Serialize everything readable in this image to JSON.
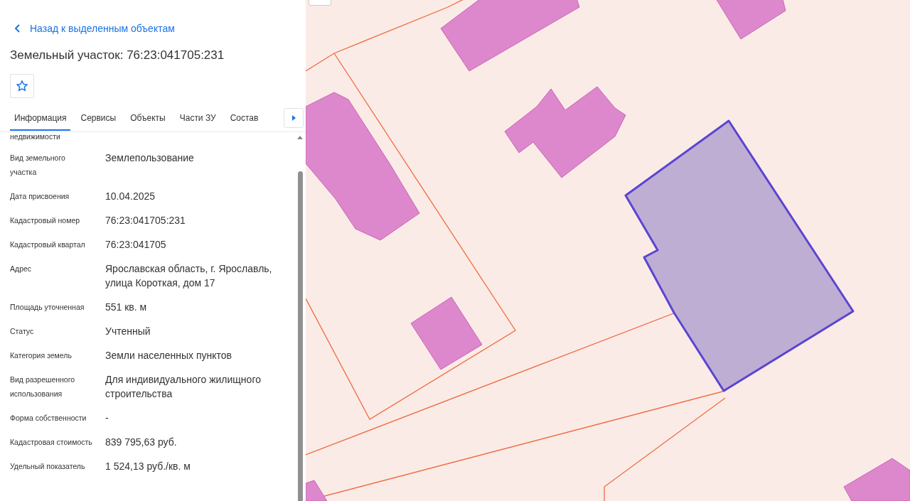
{
  "back_link": {
    "label": "Назад к выделенным объектам"
  },
  "title": "Земельный участок: 76:23:041705:231",
  "tabs": [
    {
      "label": "Информация",
      "selected": true
    },
    {
      "label": "Сервисы",
      "selected": false
    },
    {
      "label": "Объекты",
      "selected": false
    },
    {
      "label": "Части ЗУ",
      "selected": false
    },
    {
      "label": "Состав",
      "selected": false
    }
  ],
  "properties": [
    {
      "label": "недвижимости"
    },
    {
      "label": "Вид земельного участка",
      "value": "Землепользование"
    },
    {
      "label": "Дата присвоения",
      "value": "10.04.2025"
    },
    {
      "label": "Кадастровый номер",
      "value": "76:23:041705:231"
    },
    {
      "label": "Кадастровый квартал",
      "value": "76:23:041705"
    },
    {
      "label": "Адрес",
      "value": "Ярославская область, г. Ярославль, улица Короткая, дом 17"
    },
    {
      "label": "Площадь уточненная",
      "value": "551 кв. м"
    },
    {
      "label": "Статус",
      "value": "Учтенный"
    },
    {
      "label": "Категория земель",
      "value": "Земли населенных пунктов"
    },
    {
      "label": "Вид разрешенного использования",
      "value": "Для индивидуального жилищного строительства"
    },
    {
      "label": "Форма собственности",
      "value": "-"
    },
    {
      "label": "Кадастровая стоимость",
      "value": "839 795,63 руб."
    },
    {
      "label": "Удельный показатель",
      "value": "1 524,13 руб./кв. м"
    }
  ]
}
